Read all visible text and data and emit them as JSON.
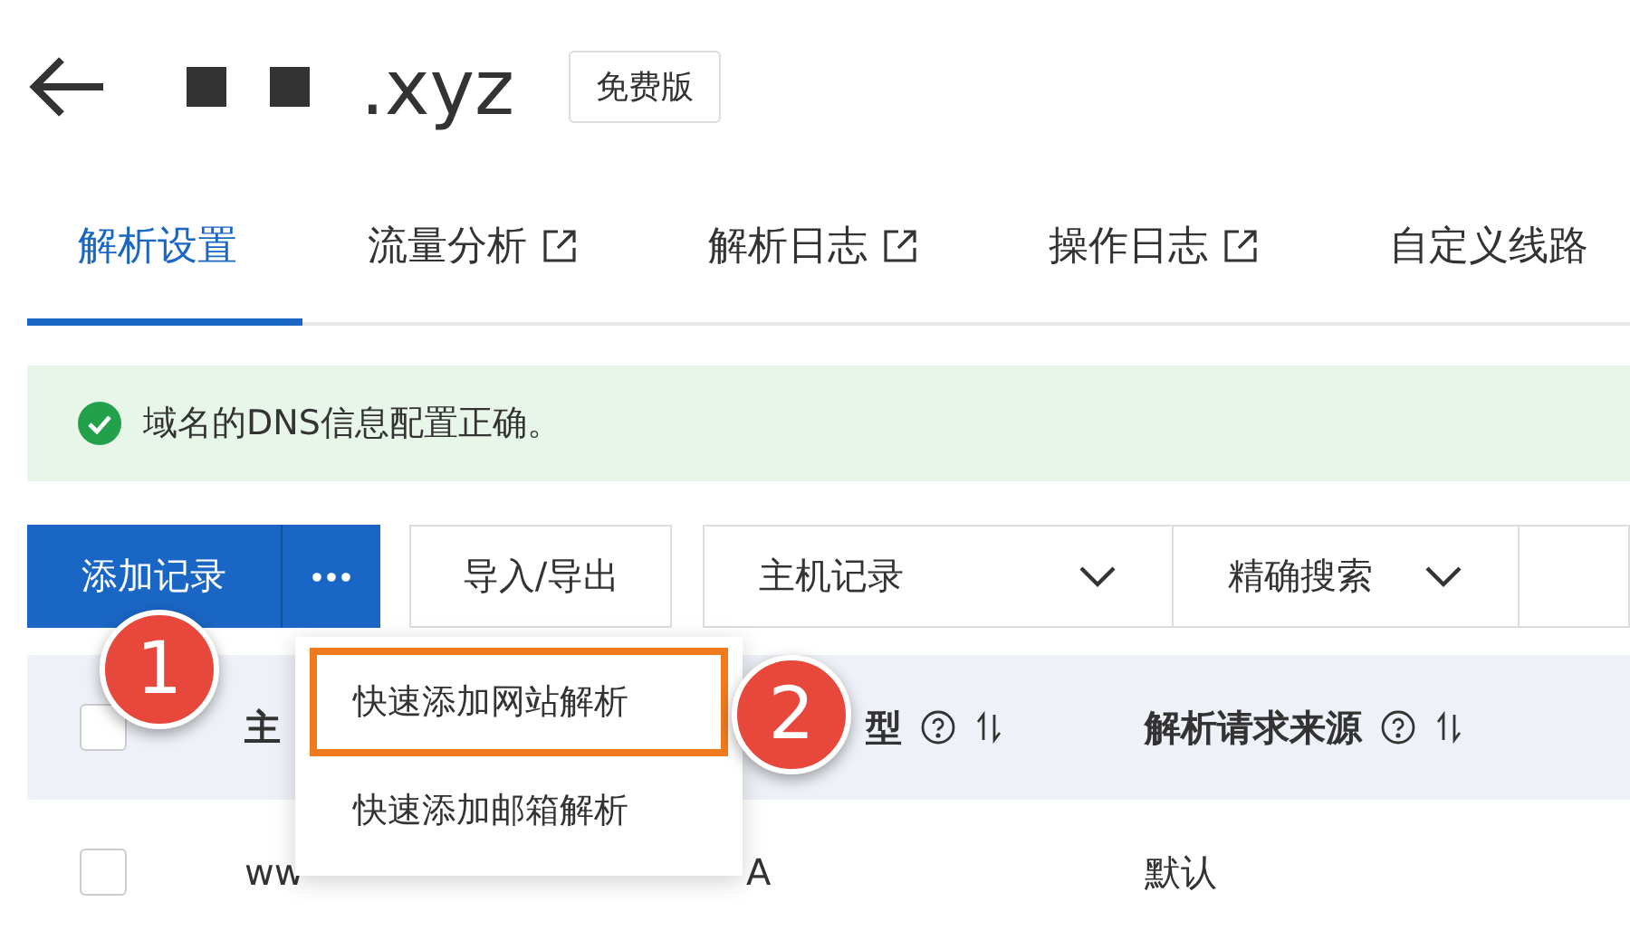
{
  "header": {
    "title": ".xyz",
    "badge": "免费版"
  },
  "tabs": [
    {
      "label": "解析设置",
      "selected": true,
      "external": false
    },
    {
      "label": "流量分析",
      "selected": false,
      "external": true
    },
    {
      "label": "解析日志",
      "selected": false,
      "external": true
    },
    {
      "label": "操作日志",
      "selected": false,
      "external": true
    },
    {
      "label": "自定义线路",
      "selected": false,
      "external": false
    }
  ],
  "alert": {
    "kind": "success",
    "text": "域名的DNS信息配置正确。"
  },
  "toolbar": {
    "add_button": "添加记录",
    "import_button": "导入/导出",
    "selects": [
      {
        "value": "主机记录"
      },
      {
        "value": "精确搜索"
      }
    ]
  },
  "table": {
    "header_checked": false,
    "columns": [
      {
        "label": "主"
      },
      {
        "label": "型",
        "help": true,
        "sortable": true
      },
      {
        "label": "解析请求来源",
        "help": true,
        "sortable": true
      }
    ],
    "rows": [
      {
        "checked": false,
        "cells": [
          "ww",
          "A",
          "默认"
        ]
      }
    ]
  },
  "menu": {
    "items": [
      {
        "label": "快速添加网站解析",
        "highlighted": true
      },
      {
        "label": "快速添加邮箱解析",
        "highlighted": false
      }
    ]
  },
  "callouts": [
    "1",
    "2"
  ]
}
